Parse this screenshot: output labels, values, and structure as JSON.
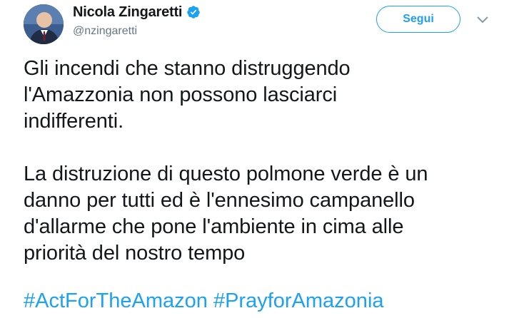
{
  "author": {
    "display_name": "Nicola Zingaretti",
    "handle": "@nzingaretti",
    "verified": true,
    "avatar_icon": "user-avatar",
    "verified_icon": "verified-badge-icon"
  },
  "actions": {
    "follow_label": "Segui",
    "menu_icon": "chevron-down-icon"
  },
  "tweet": {
    "lines_p1": [
      "Gli incendi che stanno distruggendo",
      "l'Amazzonia non possono lasciarci",
      "indifferenti."
    ],
    "lines_p2": [
      "La distruzione di questo polmone verde è un",
      "danno per tutti ed è l'ennesimo campanello",
      "d'allarme che pone l'ambiente in cima alle",
      "priorità del nostro tempo"
    ],
    "hashtags": [
      "#ActForTheAmazon",
      "#PrayforAmazonia"
    ]
  },
  "colors": {
    "accent": "#1da1f2",
    "text": "#14171a",
    "muted": "#657786"
  }
}
